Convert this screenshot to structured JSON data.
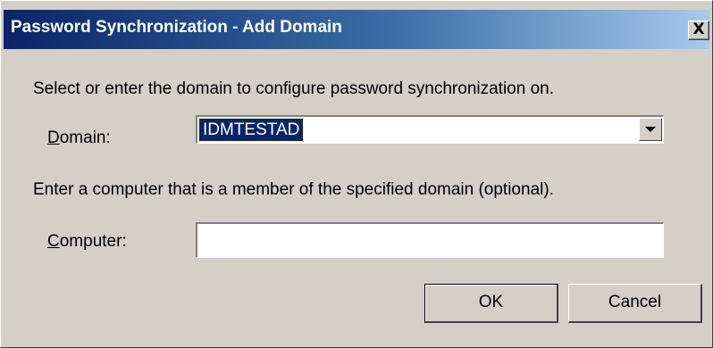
{
  "window": {
    "title": "Password Synchronization - Add Domain",
    "close_glyph": "X"
  },
  "domain_section": {
    "instruction": "Select or enter the domain to configure password synchronization on.",
    "label_mnemonic": "D",
    "label_rest": "omain:",
    "selected_value": "IDMTESTAD"
  },
  "computer_section": {
    "instruction": "Enter a computer that is a member of the specified domain (optional).",
    "label_mnemonic": "C",
    "label_rest": "omputer:",
    "value": ""
  },
  "buttons": {
    "ok": "OK",
    "cancel": "Cancel"
  }
}
